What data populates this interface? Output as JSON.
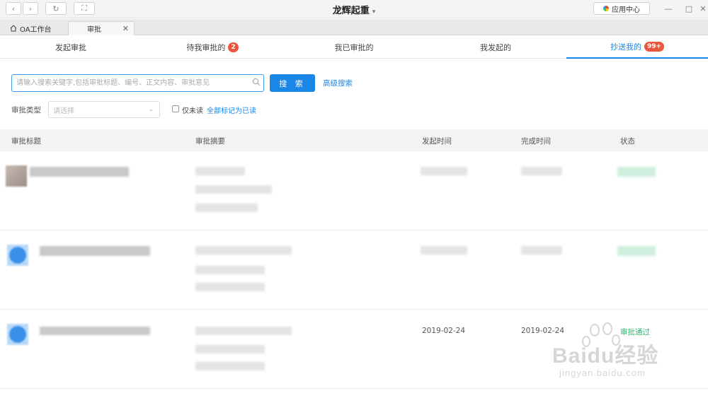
{
  "window": {
    "title": "龙辉起重",
    "app_center": "应用中心"
  },
  "doc_tabs": [
    {
      "label": "OA工作台"
    },
    {
      "label": "审批"
    }
  ],
  "subtabs": [
    {
      "label": "发起审批"
    },
    {
      "label": "待我审批的",
      "badge": "2"
    },
    {
      "label": "我已审批的"
    },
    {
      "label": "我发起的"
    },
    {
      "label": "抄送我的",
      "badge": "99+"
    }
  ],
  "search": {
    "placeholder": "请输入搜索关键字,包括审批标题、编号、正文内容、审批意见",
    "button": "搜 索",
    "advanced": "高级搜索"
  },
  "filter": {
    "type_label": "审批类型",
    "type_placeholder": "请选择",
    "unread_only": "仅未读",
    "mark_all_read": "全部标记为已读"
  },
  "table": {
    "columns": [
      "审批标题",
      "审批摘要",
      "发起时间",
      "完成时间",
      "状态"
    ],
    "rows": [
      {
        "start": "",
        "end": "",
        "status": ""
      },
      {
        "start": "",
        "end": "",
        "status": ""
      },
      {
        "start": "2019-02-24",
        "end": "2019-02-24",
        "status": "审批通过"
      }
    ]
  },
  "watermark": {
    "text": "Baidu经验",
    "url": "jingyan.baidu.com"
  },
  "colors": {
    "accent": "#1a86e8",
    "badge": "#e9573f",
    "status_ok": "#2eb872"
  }
}
